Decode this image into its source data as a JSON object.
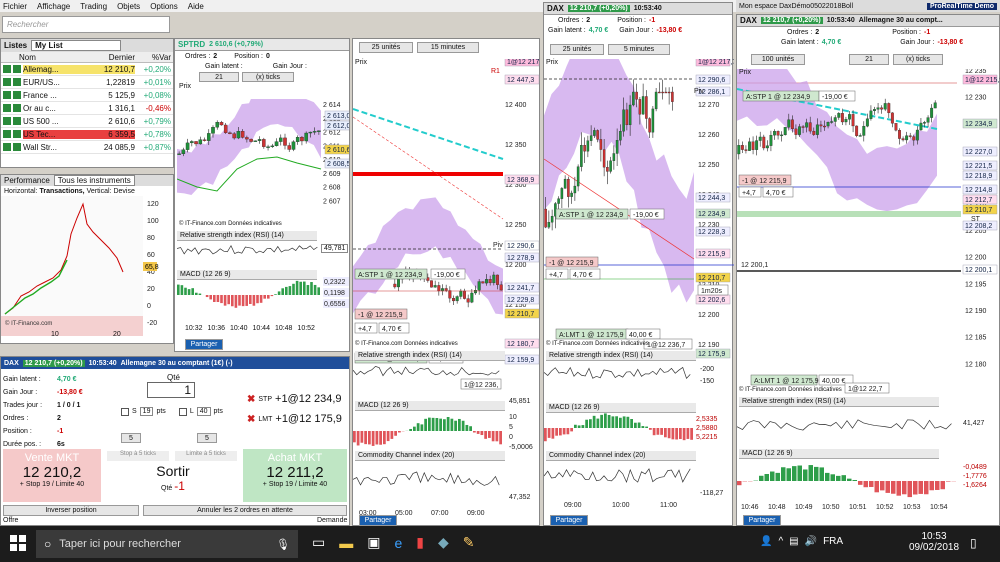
{
  "menu": [
    "Fichier",
    "Affichage",
    "Trading",
    "Objets",
    "Options",
    "Aide"
  ],
  "search": {
    "placeholder": "Rechercher"
  },
  "watchlist": {
    "tab": "Listes",
    "list_name": "My List",
    "headers": [
      "Nom",
      "Dernier",
      "%Var"
    ],
    "rows": [
      {
        "name": "Allemag...",
        "last": "12 210,7",
        "chg": "+0,20%",
        "hl": "#f6e36a"
      },
      {
        "name": "EUR/US...",
        "last": "1,22819",
        "chg": "+0,01%",
        "hl": "#fff"
      },
      {
        "name": "France ...",
        "last": "5 125,9",
        "chg": "+0,08%",
        "hl": "#fff"
      },
      {
        "name": "Or au c...",
        "last": "1 316,1",
        "chg": "-0,46%",
        "hl": "#fff"
      },
      {
        "name": "US 500 ...",
        "last": "2 610,6",
        "chg": "+0,79%",
        "hl": "#fff"
      },
      {
        "name": "US Tec...",
        "last": "6 359,5",
        "chg": "+0,78%",
        "hl": "#e84040"
      },
      {
        "name": "Wall Str...",
        "last": "24 085,9",
        "chg": "+0,87%",
        "hl": "#fff"
      }
    ]
  },
  "perf": {
    "title": "Performance",
    "dropdown": "Tous les instruments",
    "subtitle_a": "Horizontal:",
    "subtitle_b": "Transactions,",
    "subtitle_c": "Vertical: Devise",
    "yticks": [
      "120",
      "100",
      "80",
      "60",
      "40",
      "20",
      "0",
      "-20"
    ],
    "last_val": "65,8",
    "x_ticks": [
      "10",
      "20"
    ],
    "watermark": "© IT-Finance.com"
  },
  "spx": {
    "title": "SPTRD",
    "quote": "2 610,6 (+0,79%)",
    "orders_label": "Ordres :",
    "orders_val": "2",
    "position_label": "Position :",
    "position_val": "0",
    "gain_latent": "Gain latent :",
    "gain_jour": "Gain Jour :",
    "period": "21",
    "unit": "(x) ticks",
    "price_tab": "Prix",
    "yticks": [
      "2 614",
      "2 613",
      "2 612",
      "2 611",
      "2 610",
      "2 609",
      "2 608",
      "2 607"
    ],
    "tags": [
      "2 613,0",
      "2 612,0",
      "2 610,6",
      "2 608,5"
    ],
    "rsi": "Relative strength index (RSI) (14)",
    "rsi_val": "49,781",
    "macd": "MACD (12 26 9)",
    "macd_vals": [
      "0,2322",
      "0,1198",
      "0,6556"
    ],
    "xticks": [
      "10:32",
      "10:36",
      "10:40",
      "10:44",
      "10:48",
      "10:52"
    ],
    "watermark": "© IT-Finance.com Données indicatives",
    "partager": "Partager"
  },
  "ticket": {
    "title": "DAX",
    "quote": "12 210,7 (+0,20%)",
    "time": "10:53:40",
    "desc": "Allemagne 30 au comptant (1€) (-)",
    "gain_latent_label": "Gain latent :",
    "gain_latent_val": "4,70 €",
    "gain_jour_label": "Gain Jour :",
    "gain_jour_val": "-13,80 €",
    "trades_label": "Trades jour :",
    "trades_val": "1 / 0 / 1",
    "orders_label": "Ordres :",
    "orders_val": "2",
    "position_label": "Position :",
    "position_val": "-1",
    "duree_label": "Durée pos. :",
    "duree_val": "6s",
    "qty_label": "Qté",
    "qty": "1",
    "s_label": "S",
    "s_val": "19",
    "pts": "pts",
    "l_label": "L",
    "l_val": "40",
    "stp": "STP",
    "stp_val": "+1@12 234,9",
    "lmt": "LMT",
    "lmt_val": "+1@12 175,9",
    "small_a": "5",
    "small_b": "5",
    "stop5": "Stop à 5 ticks",
    "limit5": "Limite à 5 ticks",
    "vente": "Vente MKT",
    "vente_price": "12 210,2",
    "vente_sub": "+ Stop 19 / Limite 40",
    "sortir": "Sortir",
    "sortir_qty_label": "Qté",
    "sortir_qty": "-1",
    "achat": "Achat MKT",
    "achat_price": "12 211,2",
    "achat_sub": "+ Stop 19 / Limite 40",
    "inverser": "Inverser position",
    "annuler": "Annuler les 2 ordres en attente",
    "offre": "Offre",
    "demande": "Demande"
  },
  "c1": {
    "units": "25 unités",
    "period": "15 minutes",
    "price_tab": "Prix",
    "yticks": [
      "12 400",
      "12 350",
      "12 300",
      "12 250",
      "12 200",
      "12 150"
    ],
    "tags": [
      "1@12 217",
      "12 447,3",
      "12 368,9",
      "12 290,6",
      "12 278,9",
      "12 241,7",
      "12 229,8",
      "12 210,7",
      "12 180,7",
      "12 159,9"
    ],
    "r1": "R1",
    "pivot": "Piv",
    "s1": "S1",
    "stp_order": "A:STP  1 @ 12 234,9",
    "stp_gain": "-19,00 €",
    "pos_tag": "-1 @ 12 215,9",
    "pos_gain": "+4,7",
    "pos_eur": "4,70 €",
    "lmt_order": "A:LMT  1 @ 12 175,9",
    "lmt_gain": "40,00 €",
    "watermark": "© IT-Finance.com Données indicatives",
    "bottom_tag": "1@12 236,",
    "rsi": "Relative strength index (RSI) (14)",
    "rsi_val": "45,851",
    "macd": "MACD (12 26 9)",
    "macd_vals": [
      "10",
      "5",
      "0",
      "-5,0006"
    ],
    "cci": "Commodity Channel index (20)",
    "cci_val": "47,352",
    "xticks": [
      "03:00",
      "05:00",
      "07:00",
      "09:00"
    ],
    "partager": "Partager"
  },
  "c2": {
    "title": "DAX",
    "quote": "12 210,7 (+0,20%)",
    "time": "10:53:40",
    "orders_label": "Ordres :",
    "orders_val": "2",
    "position_label": "Position :",
    "position_val": "-1",
    "gain_latent": "Gain latent :",
    "gain_latent_val": "4,70 €",
    "gain_jour": "Gain Jour :",
    "gain_jour_val": "-13,80 €",
    "units": "25 unités",
    "period": "5 minutes",
    "price_tab": "Prix",
    "yticks": [
      "12 270",
      "12 260",
      "12 250",
      "12 240",
      "12 230",
      "12 220",
      "12 210",
      "12 200",
      "12 190"
    ],
    "tags": [
      "1@12 217,7",
      "12 290,6",
      "12 286,1",
      "12 244,3",
      "12 234,9",
      "12 228,3",
      "12 215,9",
      "12 210,7",
      "12 202,6",
      "12 175,9"
    ],
    "pivot": "Piv",
    "stp_order": "A:STP  1 @ 12 234,9",
    "stp_gain": "-19,00 €",
    "pos_tag": "-1 @ 12 215,9",
    "pos_gain": "+4,7",
    "pos_eur": "4,70 €",
    "lmt_order": "A:LMT  1 @ 12 175,9",
    "lmt_gain": "40,00 €",
    "countdown": "1m20s",
    "watermark": "© IT-Finance.com Données indicatives",
    "bottom_tag": "1@12 236,7",
    "rsi": "Relative strength index (RSI) (14)",
    "rsi_vals": [
      "-200",
      "-150"
    ],
    "macd": "MACD (12 26 9)",
    "macd_vals": [
      "2,5335",
      "2,5880",
      "5,2215"
    ],
    "cci": "Commodity Channel index (20)",
    "cci_val": "-118,27",
    "xticks": [
      "09:00",
      "10:00",
      "11:00"
    ],
    "partager": "Partager"
  },
  "c3": {
    "title": "DAX",
    "quote": "12 210,7 (+0,20%)",
    "time": "10:53:40",
    "desc": "Allemagne 30 au compt...",
    "orders_label": "Ordres :",
    "orders_val": "2",
    "position_label": "Position :",
    "position_val": "-1",
    "gain_latent": "Gain latent :",
    "gain_latent_val": "4,70 €",
    "gain_jour": "Gain Jour :",
    "gain_jour_val": "-13,80 €",
    "units": "100 unités",
    "period": "21",
    "unit": "(x) ticks",
    "price_tab": "Prix",
    "yticks": [
      "12 235",
      "12 230",
      "12 225",
      "12 220",
      "12 215",
      "12 210",
      "12 205",
      "12 200",
      "12 195",
      "12 190",
      "12 185",
      "12 180"
    ],
    "tags": [
      "1@12 215,9",
      "12 234,9",
      "12 227,0",
      "12 221,5",
      "12 218,9",
      "12 214,8",
      "12 212,7",
      "12 210,7",
      "12 208,2",
      "12 200,1"
    ],
    "st": "ST",
    "stp_order": "A:STP  1 @ 12 234,9",
    "stp_gain": "-19,00 €",
    "pos_tag": "-1 @ 12 215,9",
    "pos_gain": "+4,7",
    "pos_eur": "4,70 €",
    "lmt_order": "A:LMT  1 @ 12 175,9",
    "lmt_gain": "40,00 €",
    "level_line": "12 200,1",
    "watermark": "© IT-Finance.com Données indicatives",
    "bottom_tag": "1@12 22,7",
    "rsi": "Relative strength index (RSI) (14)",
    "rsi_val": "41,427",
    "macd": "MACD (12 26 9)",
    "macd_vals": [
      "-0,0489",
      "-1,7776",
      "-1,6264"
    ],
    "xticks": [
      "10:46",
      "10:48",
      "10:49",
      "10:50",
      "10:51",
      "10:52",
      "10:53",
      "10:54"
    ],
    "partager": "Partager"
  },
  "topright": {
    "workspace": "Mon espace DaxDémo05022018Boll",
    "brand": "ProRealTime Demo"
  },
  "taskbar": {
    "search": "Taper ici pour rechercher",
    "time": "10:53",
    "date": "09/02/2018",
    "lang": "FRA"
  },
  "colors": {
    "accent": "#1a60b0",
    "buy": "#2e9e4a",
    "sell": "#e0555a",
    "band": "#c79bea"
  }
}
